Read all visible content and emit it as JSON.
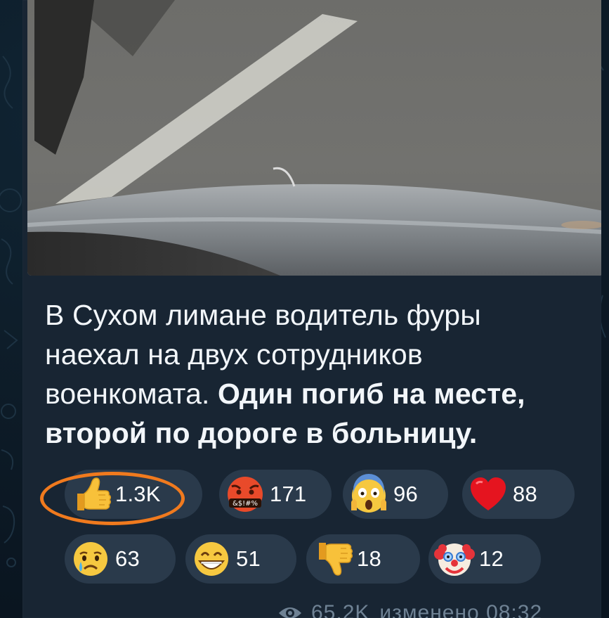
{
  "caption": {
    "part1": "В Сухом лимане водитель фуры наехал на двух сотрудников военкомата. ",
    "part2_bold": "Один погиб на месте, второй по дороге в больницу."
  },
  "reactions": [
    {
      "emoji": "thumbs-up",
      "count": "1.3K",
      "highlighted": true
    },
    {
      "emoji": "face-with-symbols-on-mouth",
      "count": "171",
      "symbols": "&$!#%"
    },
    {
      "emoji": "face-screaming-in-fear",
      "count": "96"
    },
    {
      "emoji": "red-heart",
      "count": "88"
    },
    {
      "emoji": "crying-face",
      "count": "63"
    },
    {
      "emoji": "grinning-face",
      "count": "51"
    },
    {
      "emoji": "thumbs-down",
      "count": "18"
    },
    {
      "emoji": "clown-face",
      "count": "12"
    }
  ],
  "footer": {
    "views": "65.2K",
    "edited": "изменено 08:32"
  },
  "colors": {
    "bubble": "#182533",
    "chip": "#2a3a4b",
    "highlight": "#f07a1e",
    "text": "#f2f6fa",
    "meta": "#6f8294"
  }
}
